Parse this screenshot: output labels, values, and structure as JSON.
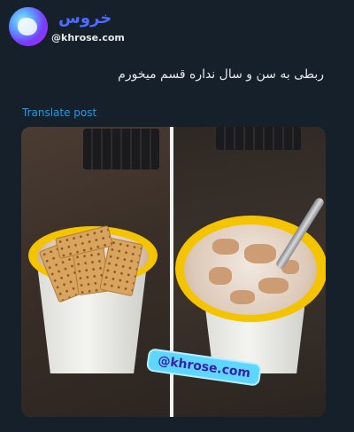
{
  "account": {
    "display_name": "خروس",
    "handle": "@khrose.com"
  },
  "post": {
    "text": "ربطی به سن و سال نداره قسم میخورم",
    "translate_label": "Translate post"
  },
  "media": {
    "watermark": "@khrose.com"
  },
  "colors": {
    "background": "#15202b",
    "link": "#1d9bf0",
    "display_name": "#4d6bff"
  }
}
